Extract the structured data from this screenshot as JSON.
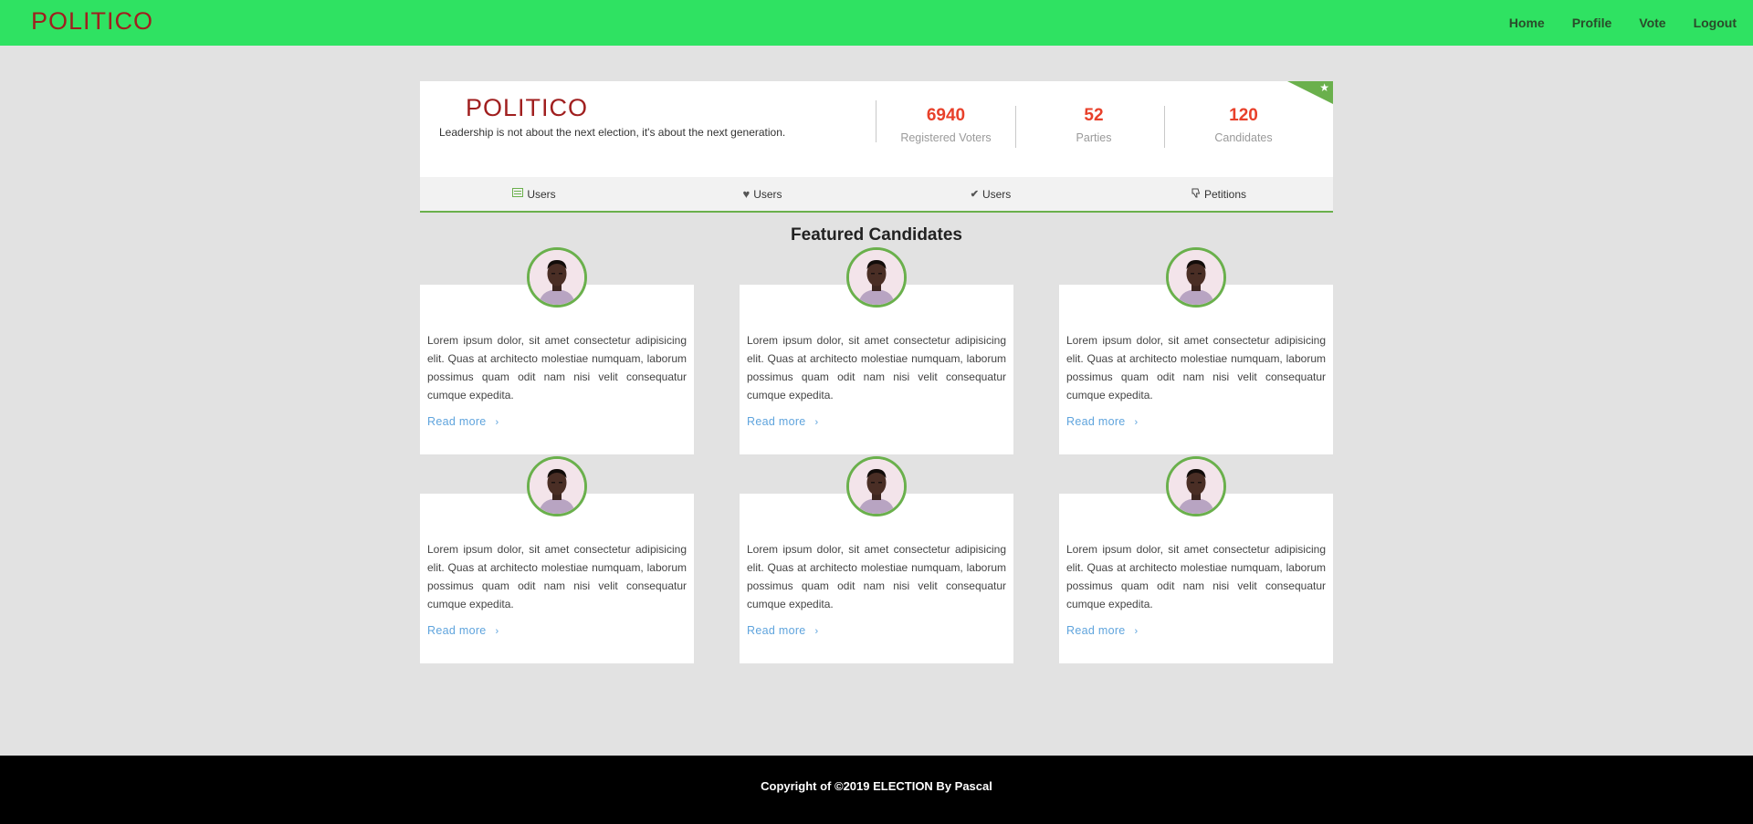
{
  "navbar": {
    "brand": "POLITICO",
    "links": [
      "Home",
      "Profile",
      "Vote",
      "Logout"
    ]
  },
  "header": {
    "title": "POLITICO",
    "slogan": "Leadership is not about the next election, it's about the next generation.",
    "stats": [
      {
        "value": "6940",
        "label": "Registered Voters"
      },
      {
        "value": "52",
        "label": "Parties"
      },
      {
        "value": "120",
        "label": "Candidates"
      }
    ],
    "ribbon_icon": "star-icon"
  },
  "tabs": [
    {
      "label": "Users",
      "icon": "list-icon"
    },
    {
      "label": "Users",
      "icon": "heart-icon"
    },
    {
      "label": "Users",
      "icon": "check-icon"
    },
    {
      "label": "Petitions",
      "icon": "thumbs-down-icon"
    }
  ],
  "section_title": "Featured Candidates",
  "candidates": [
    {
      "text": "Lorem ipsum dolor, sit amet consectetur adipisicing elit. Quas at architecto molestiae numquam, laborum possimus quam odit nam nisi velit consequatur cumque expedita.",
      "link": "Read more"
    },
    {
      "text": "Lorem ipsum dolor, sit amet consectetur adipisicing elit. Quas at architecto molestiae numquam, laborum possimus quam odit nam nisi velit consequatur cumque expedita.",
      "link": "Read more"
    },
    {
      "text": "Lorem ipsum dolor, sit amet consectetur adipisicing elit. Quas at architecto molestiae numquam, laborum possimus quam odit nam nisi velit consequatur cumque expedita.",
      "link": "Read more"
    },
    {
      "text": "Lorem ipsum dolor, sit amet consectetur adipisicing elit. Quas at architecto molestiae numquam, laborum possimus quam odit nam nisi velit consequatur cumque expedita.",
      "link": "Read more"
    },
    {
      "text": "Lorem ipsum dolor, sit amet consectetur adipisicing elit. Quas at architecto molestiae numquam, laborum possimus quam odit nam nisi velit consequatur cumque expedita.",
      "link": "Read more"
    },
    {
      "text": "Lorem ipsum dolor, sit amet consectetur adipisicing elit. Quas at architecto molestiae numquam, laborum possimus quam odit nam nisi velit consequatur cumque expedita.",
      "link": "Read more"
    }
  ],
  "footer": {
    "text": "Copyright of ©2019 ELECTION By Pascal"
  },
  "colors": {
    "navbar": "#2fe262",
    "brand": "#a01f1f",
    "accent_green": "#6ab04c",
    "stat_number": "#e8402a",
    "link_blue": "#5fa4dd",
    "footer": "#000000"
  }
}
